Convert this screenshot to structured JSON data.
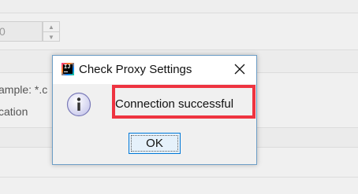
{
  "background": {
    "spinner_value": "0",
    "example_text": "ample: *.c",
    "location_text": "cation"
  },
  "dialog": {
    "title": "Check Proxy Settings",
    "message": "Connection successful",
    "ok_label": "OK",
    "icon": "info-icon",
    "highlight_color": "#ee3340"
  }
}
